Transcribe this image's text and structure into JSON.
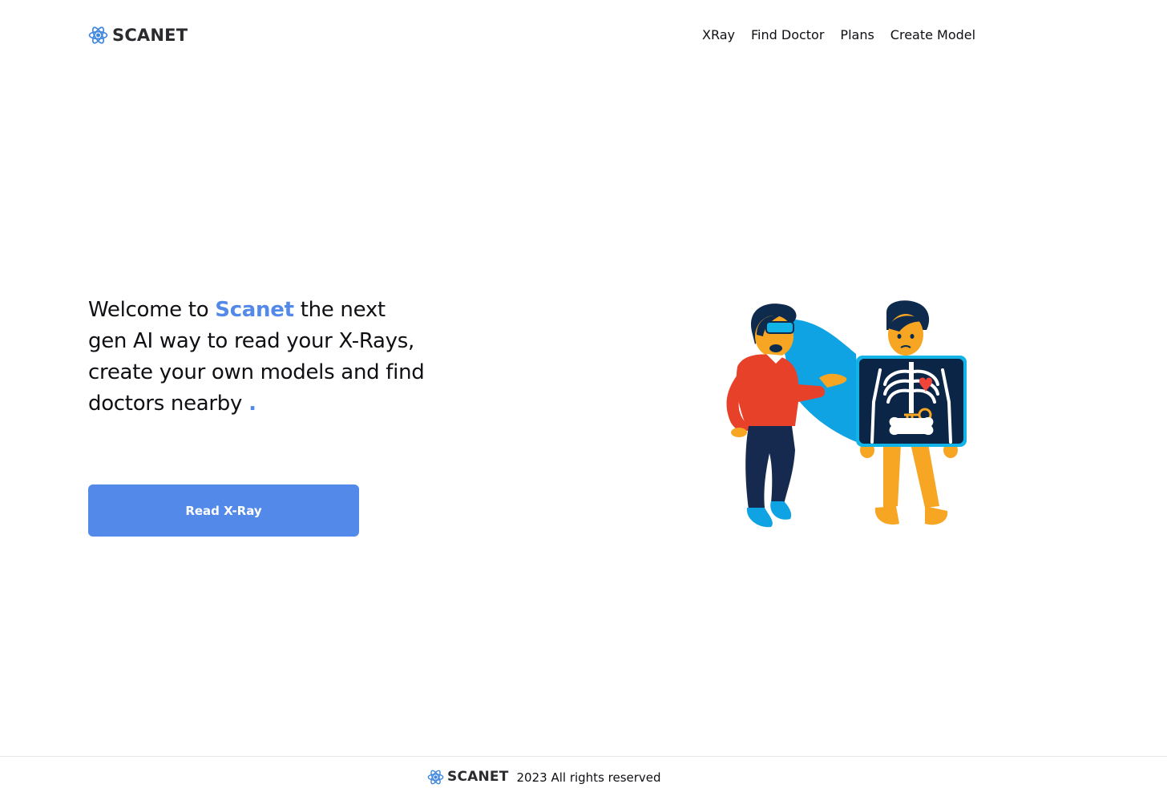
{
  "header": {
    "logo_text": "SCANET",
    "nav": [
      {
        "label": "XRay"
      },
      {
        "label": "Find Doctor"
      },
      {
        "label": "Plans"
      },
      {
        "label": "Create Model"
      }
    ]
  },
  "hero": {
    "title_prefix": "Welcome to ",
    "title_brand": "Scanet",
    "title_suffix": " the next gen AI way to read your X-Rays, create your own models and find doctors nearby ",
    "title_dot": ".",
    "cta_label": "Read X-Ray"
  },
  "footer": {
    "logo_text": "SCANET",
    "copyright": "2023 All rights reserved"
  },
  "colors": {
    "accent": "#538ae9",
    "text": "#0f0f14"
  },
  "icons": {
    "logo": "atom-icon"
  }
}
